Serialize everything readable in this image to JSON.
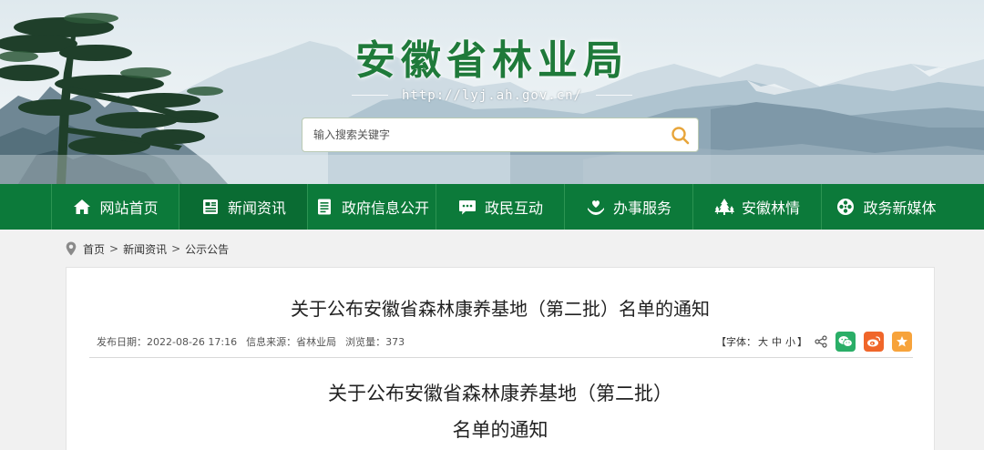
{
  "header": {
    "site_title": "安徽省林业局",
    "site_url": "http://lyj.ah.gov.cn/",
    "search_placeholder": "输入搜索关键字"
  },
  "nav": {
    "items": [
      {
        "label": "网站首页",
        "icon": "home-icon"
      },
      {
        "label": "新闻资讯",
        "icon": "news-icon"
      },
      {
        "label": "政府信息公开",
        "icon": "document-icon"
      },
      {
        "label": "政民互动",
        "icon": "chat-icon"
      },
      {
        "label": "办事服务",
        "icon": "heart-hand-icon"
      },
      {
        "label": "安徽林情",
        "icon": "forest-icon"
      },
      {
        "label": "政务新媒体",
        "icon": "media-icon"
      }
    ],
    "active_index": 1
  },
  "breadcrumb": {
    "items": [
      "首页",
      "新闻资讯",
      "公示公告"
    ],
    "separator": ">"
  },
  "article": {
    "title": "关于公布安徽省森林康养基地（第二批）名单的通知",
    "publish_date": "发布日期：2022-08-26 17:16",
    "source": "信息来源：省林业局",
    "views": "浏览量：373",
    "font_size_label": "【字体：",
    "font_large": "大",
    "font_medium": "中",
    "font_small": "小",
    "font_close": "】",
    "heading_line1": "关于公布安徽省森林康养基地（第二批）",
    "heading_line2": "名单的通知"
  },
  "share": [
    {
      "name": "wechat",
      "color": "#2aae67"
    },
    {
      "name": "weibo",
      "color": "#f0662a"
    },
    {
      "name": "favorite",
      "color": "#f7a33b"
    }
  ],
  "colors": {
    "nav_green": "#0c7a3a",
    "title_green": "#1f7a3a"
  }
}
